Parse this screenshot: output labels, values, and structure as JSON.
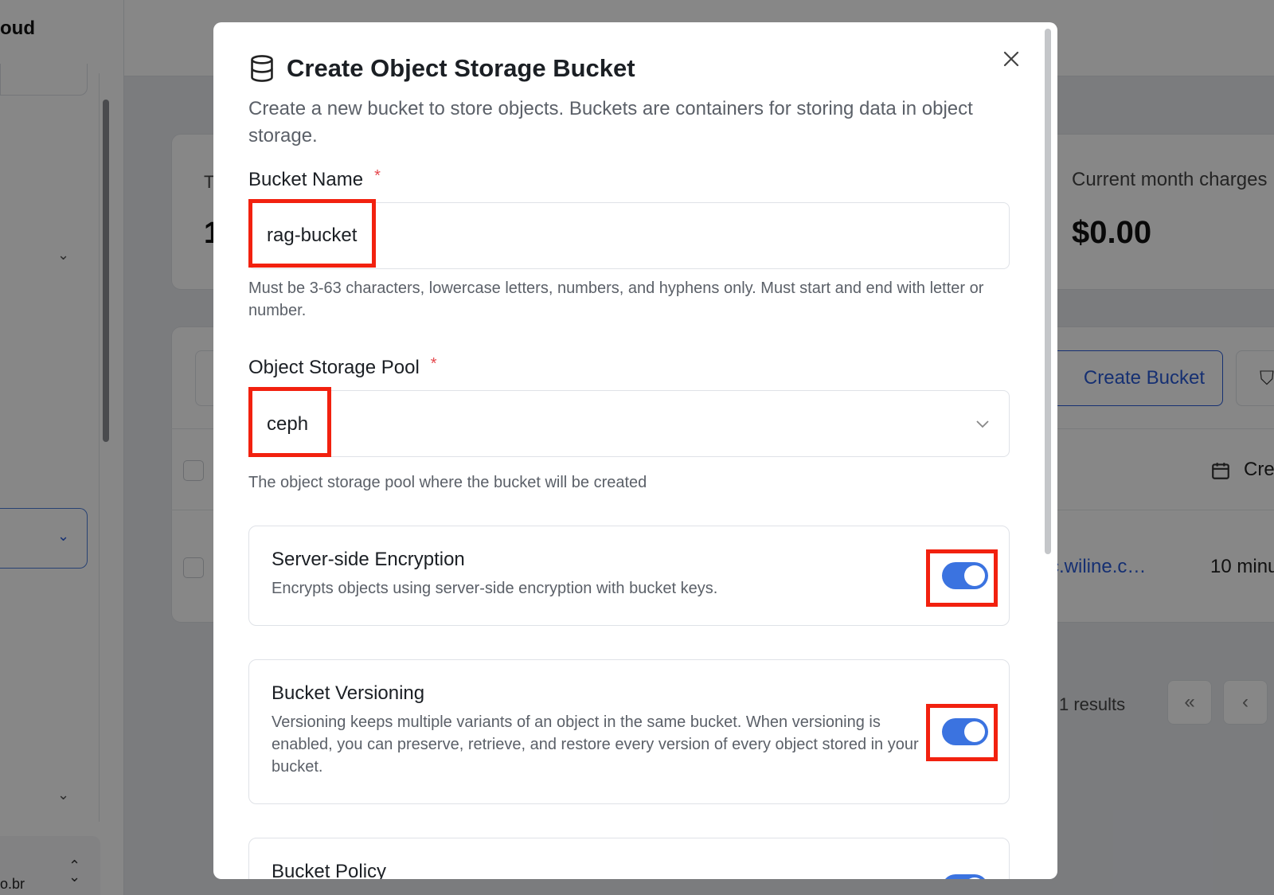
{
  "background": {
    "brand_fragment": "oud",
    "card_fragment_label": "T",
    "card_fragment_value": "1",
    "charges_label": "Current month charges",
    "charges_value": "$0.00",
    "create_bucket_label": "Create Bucket",
    "created_col_fragment": "Cre",
    "row_link_fragment": "c.wiline.c…",
    "row_time_fragment": "10 minu",
    "results_text": "1 results",
    "page_first": "«",
    "page_prev": "‹",
    "user_fragment": "o.br"
  },
  "modal": {
    "title": "Create Object Storage Bucket",
    "title_icon": "database-icon",
    "description": "Create a new bucket to store objects. Buckets are containers for storing data in object storage.",
    "bucket_name": {
      "label": "Bucket Name",
      "required_mark": "*",
      "value": "rag-bucket",
      "helper": "Must be 3-63 characters, lowercase letters, numbers, and hyphens only. Must start and end with letter or number."
    },
    "pool": {
      "label": "Object Storage Pool",
      "required_mark": "*",
      "value": "ceph",
      "helper": "The object storage pool where the bucket will be created"
    },
    "encryption": {
      "title": "Server-side Encryption",
      "description": "Encrypts objects using server-side encryption with bucket keys.",
      "enabled": true
    },
    "versioning": {
      "title": "Bucket Versioning",
      "description": "Versioning keeps multiple variants of an object in the same bucket. When versioning is enabled, you can preserve, retrieve, and restore every version of every object stored in your bucket.",
      "enabled": true
    },
    "policy": {
      "title": "Bucket Policy",
      "enabled": true
    }
  },
  "colors": {
    "accent": "#3b73e0",
    "highlight": "#f2210f",
    "required": "#e5484d"
  }
}
